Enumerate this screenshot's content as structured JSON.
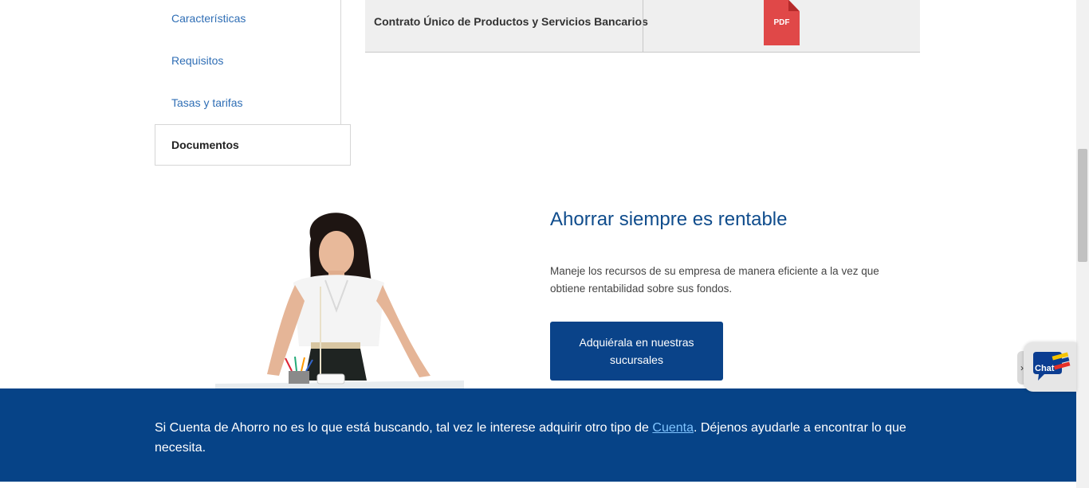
{
  "sidebar": {
    "items": [
      {
        "label": "Características"
      },
      {
        "label": "Requisitos"
      },
      {
        "label": "Tasas y tarifas"
      },
      {
        "label": "Documentos",
        "active": true
      }
    ]
  },
  "documents": {
    "rows": [
      {
        "name": "Contrato Único de Productos y Servicios Bancarios",
        "file_type": "PDF",
        "icon": "pdf-file-icon"
      }
    ]
  },
  "promo": {
    "title": "Ahorrar siempre es rentable",
    "text": "Maneje los recursos de su empresa de manera eficiente a la vez que obtiene rentabilidad sobre sus fondos.",
    "button_label": "Adquiérala en nuestras sucursales"
  },
  "banner": {
    "text_before": "Si Cuenta de Ahorro no es lo que está buscando, tal vez le interese adquirir otro tipo de ",
    "link_label": "Cuenta",
    "text_after": ". Déjenos ayudarle a encontrar lo que necesita."
  },
  "chat": {
    "label": "Chat",
    "toggle_icon": "chevron-right-icon"
  },
  "colors": {
    "brand_blue": "#064387",
    "button_blue": "#0a4389",
    "link_blue": "#2f6eb5",
    "title_blue": "#0f4c8c",
    "pdf_red": "#e04848"
  }
}
